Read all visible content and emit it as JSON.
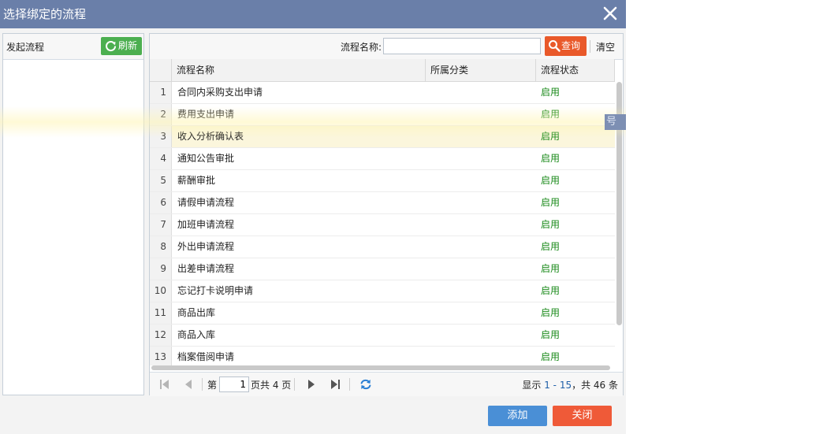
{
  "dialog": {
    "title": "选择绑定的流程",
    "add_label": "添加",
    "close_label": "关闭"
  },
  "left_panel": {
    "title": "发起流程",
    "refresh_label": "刷新"
  },
  "toolbar": {
    "name_label": "流程名称:",
    "search_value": "",
    "query_label": "查询",
    "clear_label": "清空"
  },
  "grid": {
    "columns": [
      "流程名称",
      "所属分类",
      "流程状态"
    ],
    "rows": [
      {
        "num": "1",
        "name": "合同内采购支出申请",
        "category": "",
        "status": "启用"
      },
      {
        "num": "2",
        "name": "费用支出申请",
        "category": "",
        "status": "启用"
      },
      {
        "num": "3",
        "name": "收入分析确认表",
        "category": "",
        "status": "启用"
      },
      {
        "num": "4",
        "name": "通知公告审批",
        "category": "",
        "status": "启用"
      },
      {
        "num": "5",
        "name": "薪酬审批",
        "category": "",
        "status": "启用"
      },
      {
        "num": "6",
        "name": "请假申请流程",
        "category": "",
        "status": "启用"
      },
      {
        "num": "7",
        "name": "加班申请流程",
        "category": "",
        "status": "启用"
      },
      {
        "num": "8",
        "name": "外出申请流程",
        "category": "",
        "status": "启用"
      },
      {
        "num": "9",
        "name": "出差申请流程",
        "category": "",
        "status": "启用"
      },
      {
        "num": "10",
        "name": "忘记打卡说明申请",
        "category": "",
        "status": "启用"
      },
      {
        "num": "11",
        "name": "商品出库",
        "category": "",
        "status": "启用"
      },
      {
        "num": "12",
        "name": "商品入库",
        "category": "",
        "status": "启用"
      },
      {
        "num": "13",
        "name": "档案借阅申请",
        "category": "",
        "status": "启用"
      }
    ]
  },
  "pager": {
    "page_prefix": "第",
    "current_page": "1",
    "page_suffix": "页共 4 页",
    "display_prefix": "显示 ",
    "display_range": "1 - 15",
    "display_suffix": "，共 46 条"
  },
  "overlay": {
    "side_tag": "号秘"
  },
  "colors": {
    "titlebar": "#6a7fa9",
    "refresh": "#4caf50",
    "query": "#e9592a",
    "status_enabled": "#1a8a1a",
    "add": "#4a8fd6",
    "close": "#ef5a38"
  }
}
